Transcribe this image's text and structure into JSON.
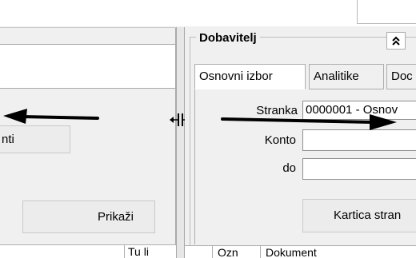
{
  "left": {
    "partial_button_label": "nti",
    "show_button_label": "Prikaži",
    "grid_partial_col": "Tu  li"
  },
  "right": {
    "group_title": "Dobavitelj",
    "collapse_symbol": "≈",
    "tabs": [
      {
        "label": "Osnovni izbor",
        "active": true
      },
      {
        "label": "Analitike",
        "active": false
      },
      {
        "label": "Doc",
        "active": false
      }
    ],
    "fields": {
      "stranka_label": "Stranka",
      "stranka_value": "0000001 - Osnov",
      "konto_label": "Konto",
      "konto_value": "",
      "do_label": "do",
      "do_value": ""
    },
    "card_button_label": "Kartica stran",
    "grid_cols": [
      "Ozn",
      "Dokument"
    ]
  },
  "icons": {
    "splitter": "horizontal-resize-icon",
    "arrow_left": "arrow-left-annotation",
    "arrow_right": "arrow-right-annotation"
  }
}
